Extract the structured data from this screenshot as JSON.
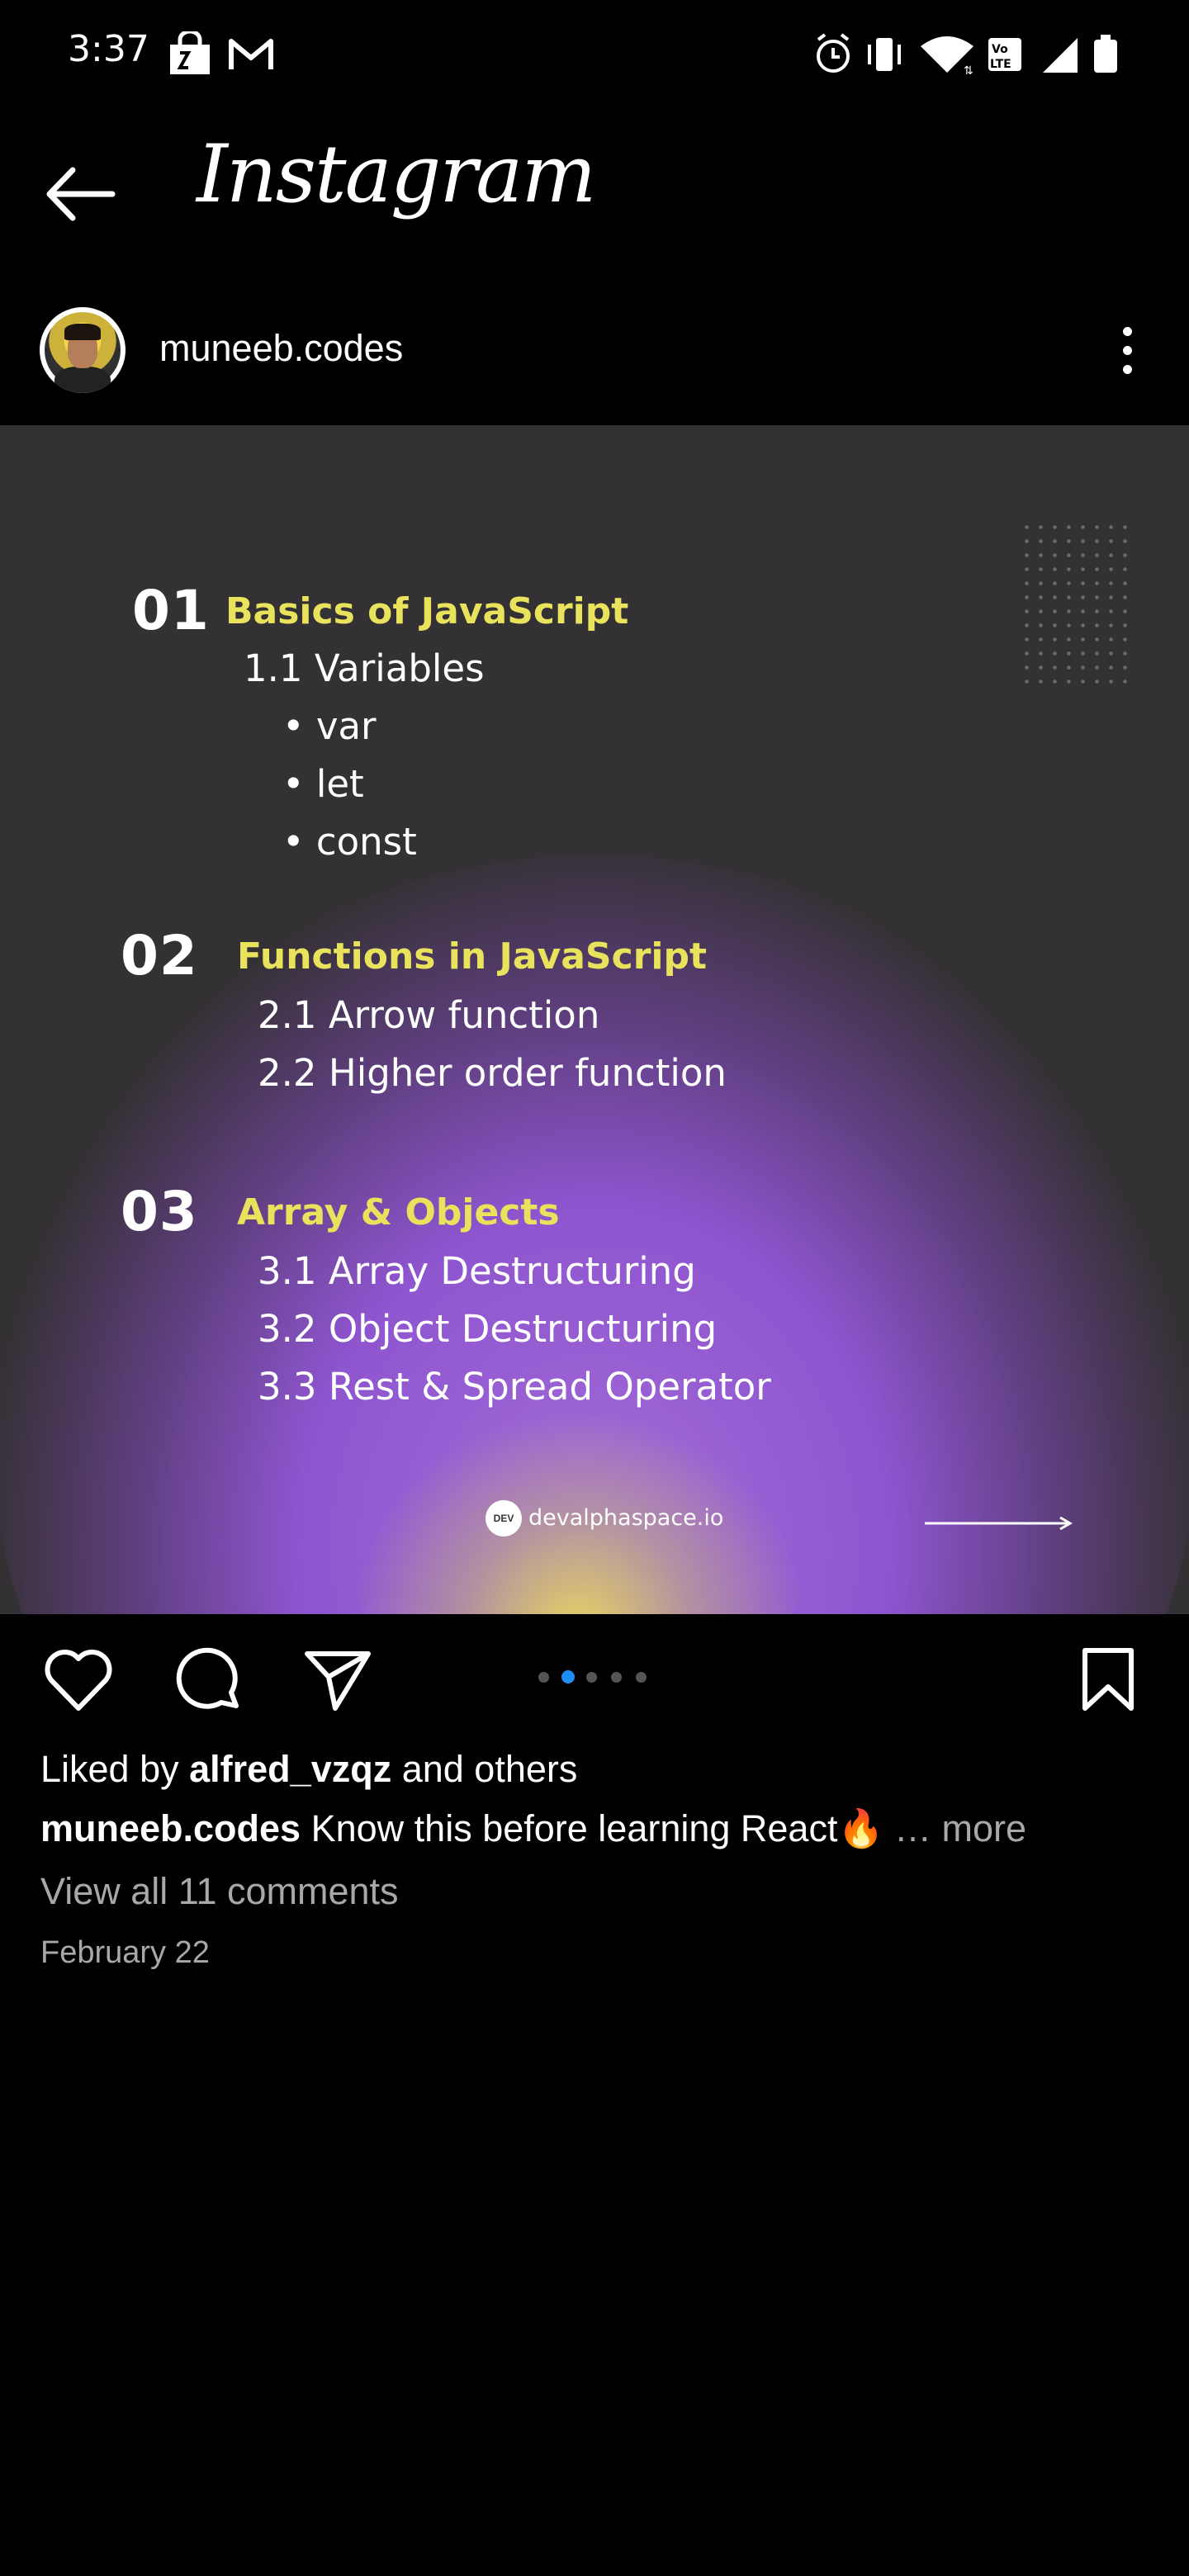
{
  "status_bar": {
    "time": "3:37",
    "icons": [
      "bag-icon",
      "gmail-icon",
      "alarm-icon",
      "vibrate-icon",
      "wifi-icon",
      "volte-icon",
      "signal-icon",
      "battery-icon"
    ]
  },
  "header": {
    "title": "Instagram"
  },
  "post": {
    "username": "muneeb.codes",
    "sections": [
      {
        "number": "01",
        "title": "Basics of JavaScript",
        "items": [
          "1.1 Variables",
          "• var",
          "• let",
          "• const"
        ]
      },
      {
        "number": "02",
        "title": "Functions in JavaScript",
        "items": [
          "2.1 Arrow function",
          "2.2 Higher order function"
        ]
      },
      {
        "number": "03",
        "title": "Array & Objects",
        "items": [
          "3.1 Array Destructuring",
          "3.2 Object Destructuring",
          "3.3 Rest & Spread Operator"
        ]
      }
    ],
    "credit_logo": "DEV",
    "credit": "devalphaspace.io",
    "carousel": {
      "count": 5,
      "active": 2
    }
  },
  "engagement": {
    "liked_by_prefix": "Liked by ",
    "liked_by_user": "alfred_vzqz",
    "liked_by_suffix": " and others",
    "caption_user": "muneeb.codes",
    "caption_text": " Know this before learning React🔥",
    "caption_more": "… more",
    "view_comments": "View all 11 comments",
    "date": "February 22"
  },
  "colors": {
    "background": "#000000",
    "accent_yellow": "#e8e25c",
    "purple": "#8e55cf",
    "active_dot": "#1e8cf5"
  }
}
